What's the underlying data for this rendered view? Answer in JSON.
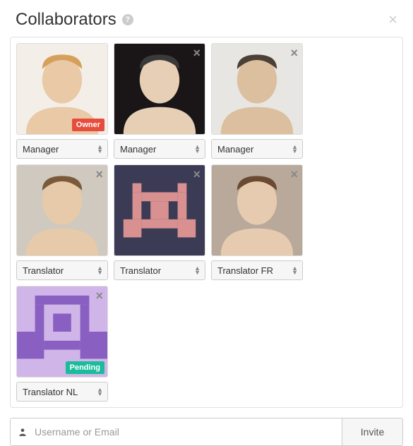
{
  "header": {
    "title": "Collaborators",
    "help_glyph": "?",
    "close_glyph": "×"
  },
  "badges": {
    "owner": "Owner",
    "pending": "Pending"
  },
  "collaborators": [
    {
      "role": "Manager",
      "badge": "owner",
      "removable": false,
      "avatar_type": "photo1"
    },
    {
      "role": "Manager",
      "badge": null,
      "removable": true,
      "avatar_type": "photo2"
    },
    {
      "role": "Manager",
      "badge": null,
      "removable": true,
      "avatar_type": "photo3"
    },
    {
      "role": "Translator",
      "badge": null,
      "removable": true,
      "avatar_type": "photo4"
    },
    {
      "role": "Translator",
      "badge": null,
      "removable": true,
      "avatar_type": "identicon1"
    },
    {
      "role": "Translator FR",
      "badge": null,
      "removable": true,
      "avatar_type": "photo5"
    },
    {
      "role": "Translator NL",
      "badge": "pending",
      "removable": true,
      "avatar_type": "identicon2"
    }
  ],
  "invite": {
    "placeholder": "Username or Email",
    "button": "Invite",
    "icon_glyph": "👤"
  },
  "remove_glyph": "×"
}
